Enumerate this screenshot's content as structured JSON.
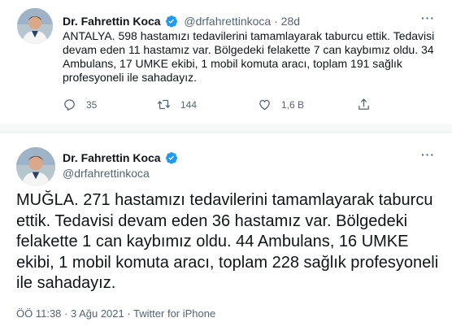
{
  "tweet1": {
    "name": "Dr. Fahrettin Koca",
    "handle": "@drfahrettinkoca",
    "separator": "·",
    "age": "28d",
    "text": "ANTALYA. 598 hastamızı tedavilerini tamamlayarak taburcu ettik. Tedavisi devam eden 11 hastamız var. Bölgedeki felakette 7 can kaybımız oldu. 34 Ambulans, 17 UMKE ekibi, 1 mobil komuta aracı, toplam 191 sağlık profesyoneli ile sahadayız.",
    "actions": {
      "replies": "35",
      "retweets": "144",
      "likes": "1,6 B"
    }
  },
  "tweet2": {
    "name": "Dr. Fahrettin Koca",
    "handle": "@drfahrettinkoca",
    "text": "MUĞLA. 271 hastamızı tedavilerini tamamlayarak taburcu ettik. Tedavisi devam eden 36 hastamız var. Bölgedeki felakette 1 can kaybımız oldu. 44 Ambulans, 16 UMKE ekibi, 1 mobil komuta aracı, toplam 228 sağlık profesyoneli ile sahadayız.",
    "meta": "ÖÖ 11:38 · 3 Ağu 2021 · Twitter for iPhone"
  },
  "icons": {
    "more": "more-icon",
    "verified": "verified-badge-icon",
    "reply": "reply-icon",
    "retweet": "retweet-icon",
    "like": "like-icon",
    "share": "share-icon"
  },
  "colors": {
    "verified": "#1d9bf0",
    "secondary_text": "#536471",
    "primary_text": "#0f1419"
  }
}
